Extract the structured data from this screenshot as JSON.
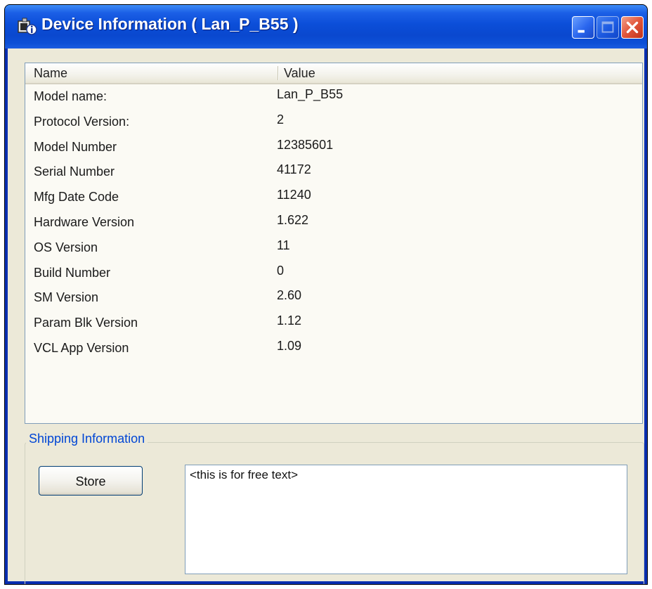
{
  "window": {
    "title": "Device Information ( Lan_P_B55 )"
  },
  "table": {
    "columns": [
      "Name",
      "Value"
    ],
    "rows": [
      {
        "name": "Model name:",
        "value": "Lan_P_B55"
      },
      {
        "name": "Protocol Version:",
        "value": "2"
      },
      {
        "name": "Model Number",
        "value": "12385601"
      },
      {
        "name": "Serial Number",
        "value": "41172"
      },
      {
        "name": "Mfg Date Code",
        "value": "11240"
      },
      {
        "name": "Hardware Version",
        "value": "1.622"
      },
      {
        "name": "OS Version",
        "value": "11"
      },
      {
        "name": "Build Number",
        "value": "0"
      },
      {
        "name": "SM Version",
        "value": "2.60"
      },
      {
        "name": "Param Blk Version",
        "value": "1.12"
      },
      {
        "name": "VCL App Version",
        "value": "1.09"
      }
    ]
  },
  "shipping": {
    "group_label": "Shipping Information",
    "store_label": "Store",
    "free_text": "<this is for free text>"
  },
  "colors": {
    "titlebar": "#0b4ed8",
    "client_bg": "#ece9d8",
    "group_label": "#0046d5",
    "close_button": "#e2553a"
  },
  "icons": {
    "app": "device-info-icon",
    "minimize": "minimize-icon",
    "maximize": "maximize-icon",
    "close": "close-icon"
  }
}
